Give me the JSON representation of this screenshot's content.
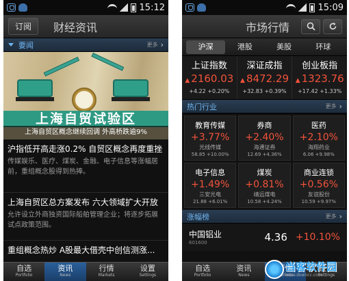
{
  "left": {
    "status_time": "15:12",
    "subscribe_button": "订阅",
    "title": "财经资讯",
    "section": {
      "title": "要闻",
      "more": "更多"
    },
    "banner": {
      "headline": "上海自贸试验区",
      "caption": "上海自贸区概念继续回调 外高桥跌逾9%"
    },
    "news": [
      {
        "title": "沪指低开高走涨0.2% 自贸区概念再度重挫",
        "summary": "传媒娱乐、医疗、煤炭、金融、电子信息等涨幅居前，重组概念股得到热捧。"
      },
      {
        "title": "上海自贸区总方案发布 六大领域扩大开放",
        "summary": "允许设立外商独资国际船舶管理企业；将逐步拓展试点政策范围。"
      },
      {
        "title": "重组概念热炒 A股最大借壳中创信测涨..."
      }
    ]
  },
  "right": {
    "status_time": "15:09",
    "title": "市场行情",
    "tabs": [
      "沪深",
      "港股",
      "美股",
      "环球"
    ],
    "active_tab": 0,
    "indices": [
      {
        "name": "上证指数",
        "value": "2160.03",
        "change": "+4.22 +0.20%"
      },
      {
        "name": "深证成指",
        "value": "8472.29",
        "change": "+32.83 +0.39%"
      },
      {
        "name": "创业板指",
        "value": "1323.76",
        "change": "+17.42 +1.33%"
      }
    ],
    "hot_section": {
      "title": "热门行业",
      "more": "更多"
    },
    "sectors": [
      {
        "name": "教育传媒",
        "pct": "+3.77%",
        "stock": "光线传媒",
        "detail": "58.85 +10.00%"
      },
      {
        "name": "券商",
        "pct": "+2.40%",
        "stock": "海通证券",
        "detail": "12.69 +4.36%"
      },
      {
        "name": "医药",
        "pct": "+2.10%",
        "stock": "海翔药业",
        "detail": "6.06 +9.98%"
      },
      {
        "name": "电子信息",
        "pct": "+1.49%",
        "stock": "三安光电",
        "detail": "21.88 +6.01%"
      },
      {
        "name": "煤炭",
        "pct": "+0.81%",
        "stock": "靖远煤电",
        "detail": "10.58 +4.24%"
      },
      {
        "name": "商业连锁",
        "pct": "+0.56%",
        "stock": "友谊股份",
        "detail": "10.59 +9.97%"
      }
    ],
    "gainers_section": {
      "title": "涨幅榜",
      "more": "更多"
    },
    "top_gainer": {
      "name": "中国铝业",
      "code": "601600",
      "price": "4.36",
      "pct": "+10.10%"
    }
  },
  "nav": [
    {
      "cn": "自选",
      "en": "Portfolio"
    },
    {
      "cn": "资讯",
      "en": "News"
    },
    {
      "cn": "行情",
      "en": "Markets"
    },
    {
      "cn": "设置",
      "en": "Settings"
    }
  ],
  "watermark": {
    "cn": "当客软件园",
    "en": "www.downcc.com"
  }
}
